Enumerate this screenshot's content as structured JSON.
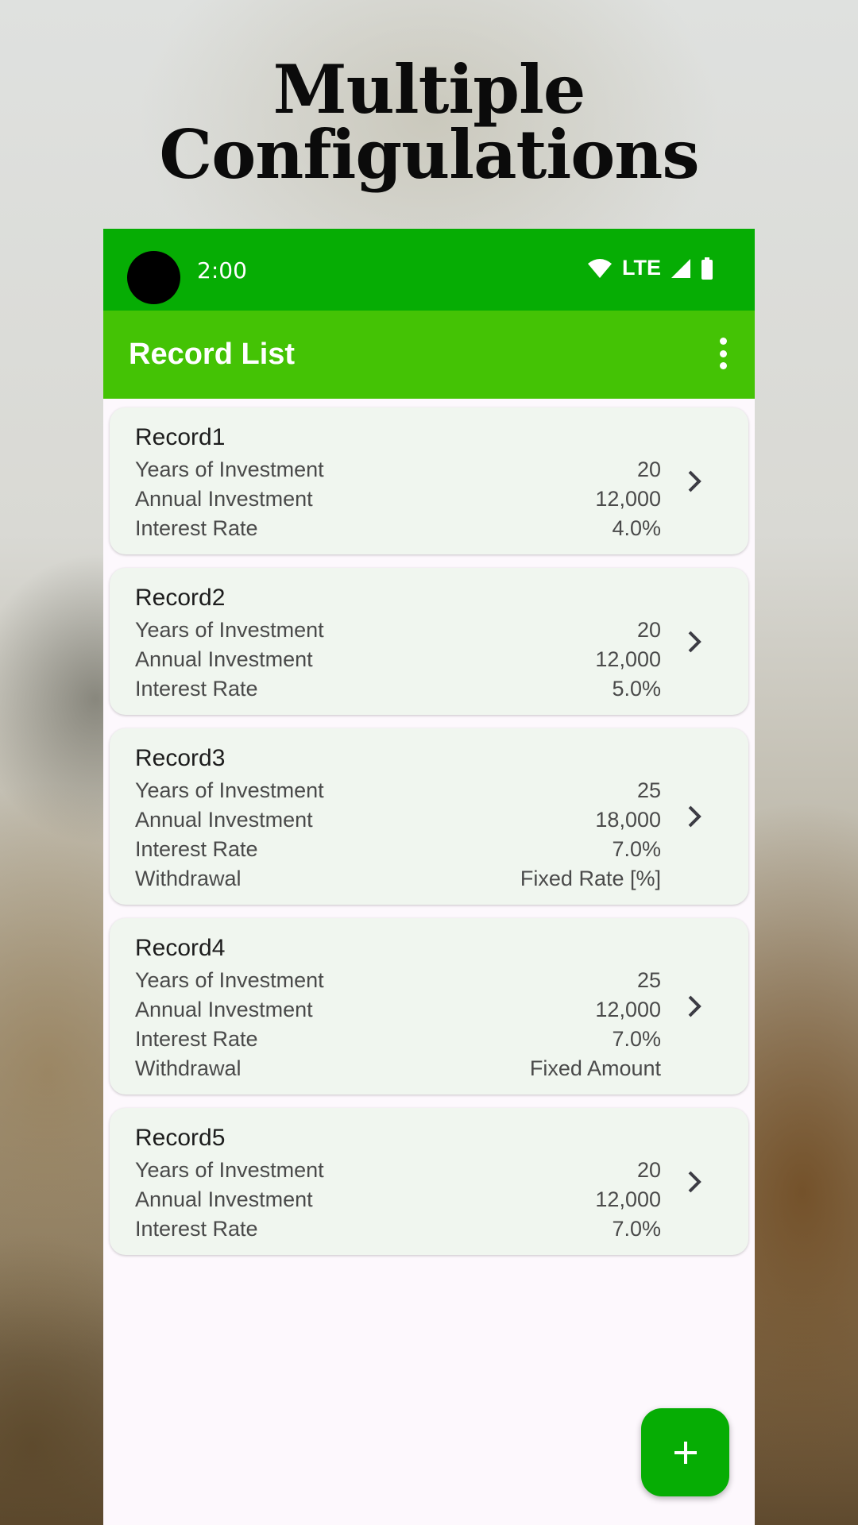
{
  "headline": {
    "line1": "Multiple",
    "line2": "Configulations"
  },
  "status_bar": {
    "time": "2:00",
    "network": "LTE"
  },
  "app_bar": {
    "title": "Record List",
    "menu_icon": "more-vert-icon"
  },
  "colors": {
    "status_bar": "#06ad04",
    "app_bar": "#44c305",
    "card": "#f0f6ef",
    "fab": "#06ad04"
  },
  "records": [
    {
      "title": "Record1",
      "rows": [
        {
          "label": "Years of Investment",
          "value": "20"
        },
        {
          "label": "Annual Investment",
          "value": "12,000"
        },
        {
          "label": "Interest Rate",
          "value": "4.0%"
        }
      ]
    },
    {
      "title": "Record2",
      "rows": [
        {
          "label": "Years of Investment",
          "value": "20"
        },
        {
          "label": "Annual Investment",
          "value": "12,000"
        },
        {
          "label": "Interest Rate",
          "value": "5.0%"
        }
      ]
    },
    {
      "title": "Record3",
      "rows": [
        {
          "label": "Years of Investment",
          "value": "25"
        },
        {
          "label": "Annual Investment",
          "value": "18,000"
        },
        {
          "label": "Interest Rate",
          "value": "7.0%"
        },
        {
          "label": "Withdrawal",
          "value": "Fixed Rate [%]"
        }
      ]
    },
    {
      "title": "Record4",
      "rows": [
        {
          "label": "Years of Investment",
          "value": "25"
        },
        {
          "label": "Annual Investment",
          "value": "12,000"
        },
        {
          "label": "Interest Rate",
          "value": "7.0%"
        },
        {
          "label": "Withdrawal",
          "value": "Fixed Amount"
        }
      ]
    },
    {
      "title": "Record5",
      "rows": [
        {
          "label": "Years of Investment",
          "value": "20"
        },
        {
          "label": "Annual Investment",
          "value": "12,000"
        },
        {
          "label": "Interest Rate",
          "value": "7.0%"
        }
      ]
    }
  ],
  "fab": {
    "icon": "plus-icon"
  }
}
